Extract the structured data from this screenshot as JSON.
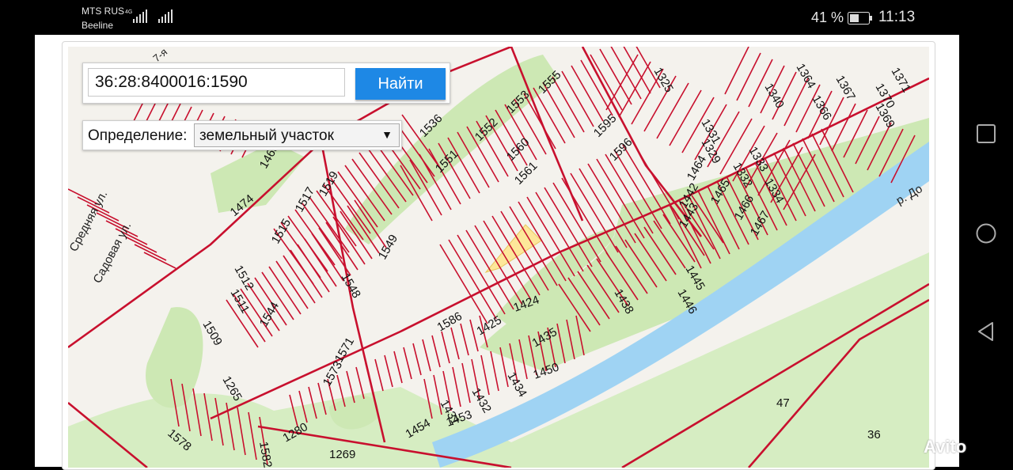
{
  "status_bar": {
    "carrier_1": "MTS RUS",
    "carrier_2": "Beeline",
    "network": "4G",
    "battery_percent": "41 %",
    "time": "11:13"
  },
  "search": {
    "value": "36:28:8400016:1590",
    "button_label": "Найти"
  },
  "definition": {
    "label": "Определение:",
    "selected": "земельный участок"
  },
  "map": {
    "river_label": "р. До",
    "street_labels": [
      "Садовая ул.",
      "Средняя ул.",
      "7-я"
    ],
    "parcel_labels": [
      "1325",
      "1364",
      "1367",
      "1371",
      "1340",
      "1366",
      "1370",
      "1369",
      "1331",
      "1329",
      "1333",
      "1332",
      "1334",
      "1555",
      "1553",
      "1552",
      "1560",
      "1595",
      "1596",
      "1551",
      "1561",
      "1536",
      "1464",
      "1465",
      "1466",
      "1467",
      "1442",
      "1443",
      "1445",
      "1446",
      "1438",
      "1463",
      "1519",
      "1474",
      "1517",
      "1515",
      "1549",
      "1512",
      "1511",
      "1548",
      "1544",
      "1586",
      "1425",
      "1424",
      "1509",
      "1571",
      "1573",
      "1435",
      "1434",
      "1450",
      "1432",
      "1431",
      "1265",
      "1453",
      "1454",
      "1578",
      "1582",
      "1280",
      "1269",
      "47",
      "36"
    ],
    "colors": {
      "parcel_outline": "#c8102e",
      "river": "#9fd3f3",
      "forest": "#cde8b4",
      "selected_parcel": "#fde79a"
    }
  },
  "navigation": {
    "buttons": [
      "recent-apps",
      "home",
      "back"
    ]
  },
  "watermark": "Avito"
}
